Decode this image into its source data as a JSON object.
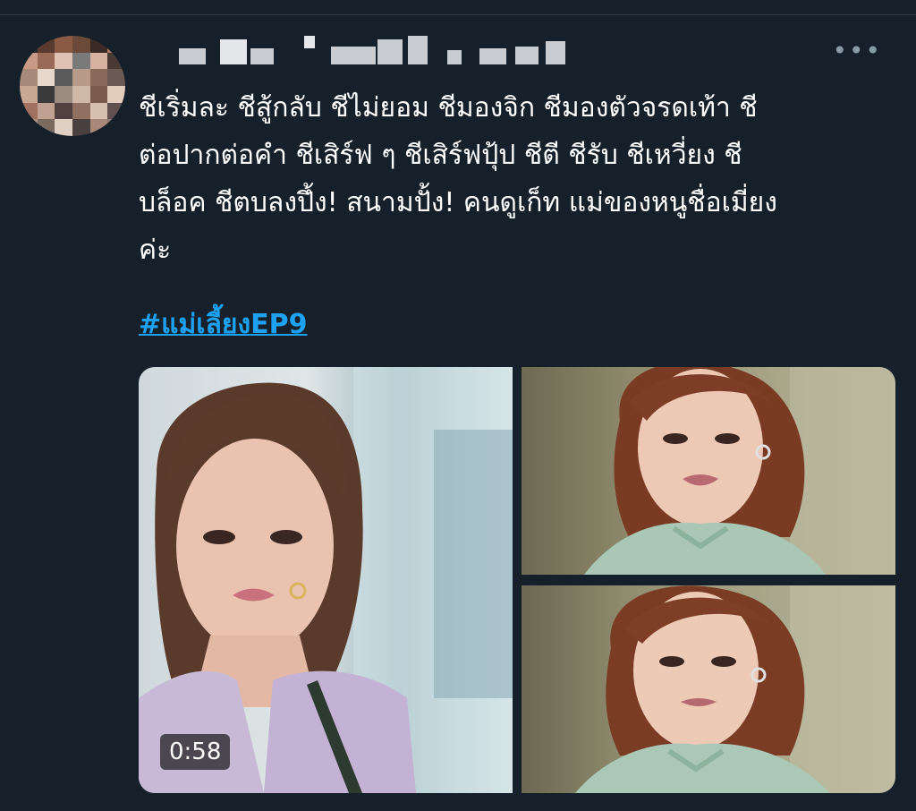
{
  "tweet": {
    "text": "ชีเริ่มละ ชีสู้กลับ ชีไม่ยอม ชีมองจิก ชีมองตัวจรดเท้า ชี\nต่อปากต่อคำ ชีเสิร์ฟ ๆ ชีเสิร์ฟปุ้ป ชีตี ชีรับ ชีเหวี่ยง ชี\nบล็อค ชีตบลงปึ้ง! สนามปั้ง! คนดูเก็ท แม่ของหนูชื่อเมี่ยง\nค่ะ",
    "hashtag": "#แม่เลี้ยงEP9"
  },
  "media": {
    "video_duration": "0:58"
  },
  "colors": {
    "background": "#15202b",
    "hashtag": "#1da1f2",
    "text": "#ffffff"
  },
  "icons": {
    "more": "more-horizontal-icon"
  }
}
